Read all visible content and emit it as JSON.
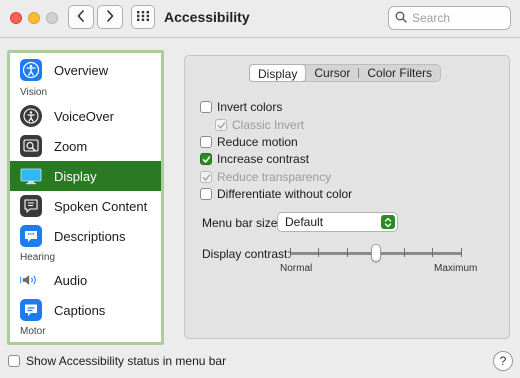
{
  "window": {
    "title": "Accessibility"
  },
  "toolbar": {
    "search": {
      "placeholder": "Search",
      "value": ""
    },
    "icons": {
      "back": "chevron-left-icon",
      "forward": "chevron-right-icon",
      "show_all": "grid-icon",
      "search": "search-icon"
    }
  },
  "sidebar": {
    "items": [
      {
        "label": "Overview",
        "icon": "accessibility-icon",
        "selected": false
      },
      {
        "label": "VoiceOver",
        "icon": "voiceover-icon",
        "selected": false
      },
      {
        "label": "Zoom",
        "icon": "zoom-icon",
        "selected": false
      },
      {
        "label": "Display",
        "icon": "display-icon",
        "selected": true
      },
      {
        "label": "Spoken Content",
        "icon": "spoken-content-icon",
        "selected": false
      },
      {
        "label": "Descriptions",
        "icon": "descriptions-icon",
        "selected": false
      },
      {
        "label": "Audio",
        "icon": "speaker-icon",
        "selected": false
      },
      {
        "label": "Captions",
        "icon": "captions-icon",
        "selected": false
      }
    ],
    "sections": [
      "Vision",
      "Hearing",
      "Motor"
    ]
  },
  "tabs": [
    {
      "label": "Display",
      "active": true
    },
    {
      "label": "Cursor",
      "active": false
    },
    {
      "label": "Color Filters",
      "active": false
    }
  ],
  "options": [
    {
      "label": "Invert colors",
      "checked": false,
      "enabled": true
    },
    {
      "label": "Classic Invert",
      "checked": true,
      "enabled": false
    },
    {
      "label": "Reduce motion",
      "checked": false,
      "enabled": true
    },
    {
      "label": "Increase contrast",
      "checked": true,
      "enabled": true
    },
    {
      "label": "Reduce transparency",
      "checked": true,
      "enabled": false
    },
    {
      "label": "Differentiate without color",
      "checked": false,
      "enabled": true
    }
  ],
  "menu_bar_size": {
    "label": "Menu bar size:",
    "value": "Default"
  },
  "display_contrast": {
    "label": "Display contrast:",
    "min_label": "Normal",
    "max_label": "Maximum",
    "value_fraction": 0.5
  },
  "footer": {
    "status_label": "Show Accessibility status in menu bar",
    "status_checked": false,
    "help_label": "?"
  },
  "colors": {
    "accent": "#2e8a24",
    "selected_row": "#2a7a23",
    "sidebar_border": "#a9cd9d"
  }
}
